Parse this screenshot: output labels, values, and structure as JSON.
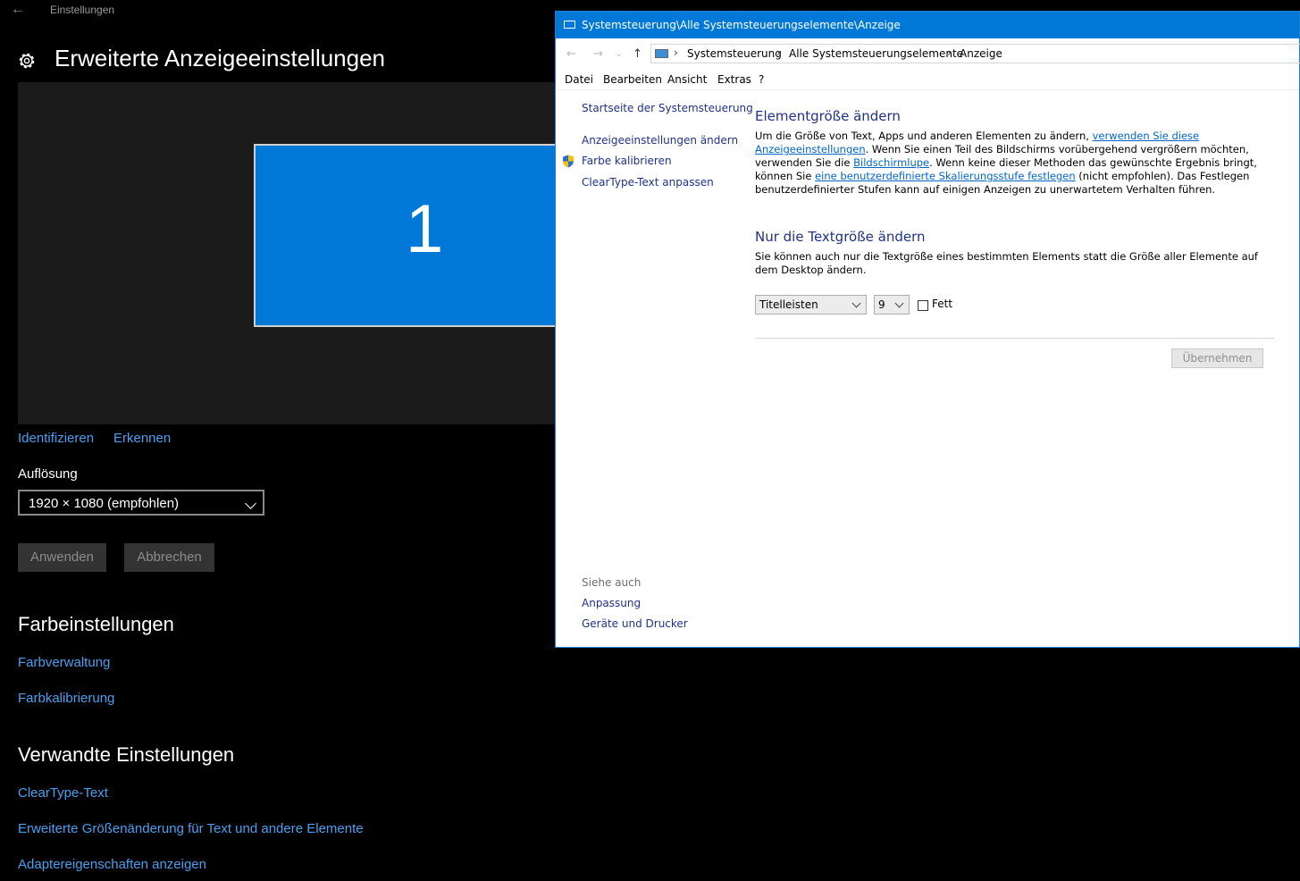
{
  "settings": {
    "app_title": "Einstellungen",
    "page_title": "Erweiterte Anzeigeeinstellungen",
    "monitor_number": "1",
    "identify_link": "Identifizieren",
    "detect_link": "Erkennen",
    "resolution_label": "Auflösung",
    "resolution_value": "1920 × 1080 (empfohlen)",
    "apply_button": "Anwenden",
    "cancel_button": "Abbrechen",
    "color_settings_heading": "Farbeinstellungen",
    "color_management_link": "Farbverwaltung",
    "color_calibration_link": "Farbkalibrierung",
    "related_heading": "Verwandte Einstellungen",
    "related_links": [
      "ClearType-Text",
      "Erweiterte Größenänderung für Text und andere Elemente",
      "Adaptereigenschaften anzeigen"
    ],
    "accent_color": "#0078d7",
    "link_color": "#4aa0f0"
  },
  "control_panel": {
    "title": "Systemsteuerung\\Alle Systemsteuerungselemente\\Anzeige",
    "breadcrumb": [
      "Systemsteuerung",
      "Alle Systemsteuerungselemente",
      "Anzeige"
    ],
    "menu": [
      "Datei",
      "Bearbeiten",
      "Ansicht",
      "Extras",
      "?"
    ],
    "sidebar": {
      "home": "Startseite der Systemsteuerung",
      "links": [
        "Anzeigeeinstellungen ändern",
        "Farbe kalibrieren",
        "ClearType-Text anpassen"
      ],
      "see_also_label": "Siehe auch",
      "see_also": [
        "Anpassung",
        "Geräte und Drucker"
      ]
    },
    "element_size": {
      "heading": "Elementgröße ändern",
      "text1": "Um die Größe von Text, Apps und anderen Elementen zu ändern, ",
      "link1": "verwenden Sie diese Anzeigeeinstellungen",
      "text2": ". Wenn Sie einen Teil des Bildschirms vorübergehend vergrößern möchten, verwenden Sie die ",
      "link2": "Bildschirmlupe",
      "text3": ". Wenn keine dieser Methoden das gewünschte Ergebnis bringt, können Sie ",
      "link3": "eine benutzerdefinierte Skalierungsstufe festlegen",
      "text4": " (nicht empfohlen). Das Festlegen benutzerdefinierter Stufen kann auf einigen Anzeigen zu unerwartetem Verhalten führen."
    },
    "text_size": {
      "heading": "Nur die Textgröße ändern",
      "description": "Sie können auch nur die Textgröße eines bestimmten Elements statt die Größe aller Elemente auf dem Desktop ändern.",
      "element_select": "Titelleisten",
      "size_select": "9",
      "bold_label": "Fett",
      "bold_checked": false,
      "apply_button": "Übernehmen"
    }
  }
}
